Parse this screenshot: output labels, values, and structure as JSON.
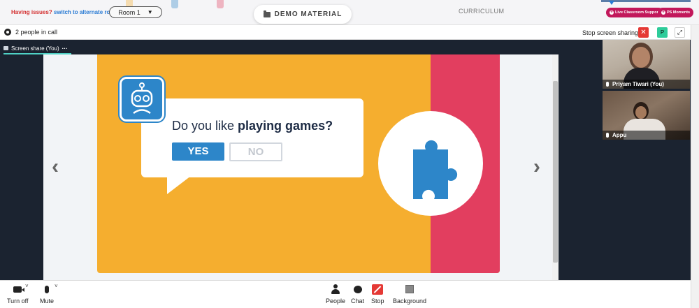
{
  "topbar": {
    "issues_label": "Having issues?",
    "switch_label": "switch to alternate room",
    "room_value": "Room 1",
    "room_caret": "▼",
    "demo_label": "DEMO MATERIAL",
    "curriculum_label": "CURRICULUM",
    "live_support_label": "Live Classroom Support",
    "ps_moments_label": "PS Moments",
    "pill_icon": "+"
  },
  "call_header": {
    "people_count": "2 people in call",
    "stop_sharing_label": "Stop screen sharing",
    "stop_x": "✕",
    "p_badge": "P",
    "expand_glyph": "⤢"
  },
  "stage": {
    "screen_tab_label": "Screen share (You)",
    "more_glyph": "···",
    "prev_arrow": "‹",
    "next_arrow": "›"
  },
  "slide": {
    "question_prefix": "Do you like ",
    "question_bold": "playing games?",
    "yes_label": "YES",
    "no_label": "NO"
  },
  "participants": [
    {
      "name": "Priyam Tiwari (You)"
    },
    {
      "name": "Appu"
    }
  ],
  "toolbar": {
    "camera_label": "Turn off",
    "mute_label": "Mute",
    "people_label": "People",
    "chat_label": "Chat",
    "stop_label": "Stop",
    "background_label": "Background",
    "chevron": "˅"
  },
  "colors": {
    "slide_orange": "#f5ae2f",
    "slide_red": "#e23e5f",
    "accent_blue": "#2d86c9",
    "brand_pink": "#c2185b",
    "danger_red": "#e53935"
  }
}
